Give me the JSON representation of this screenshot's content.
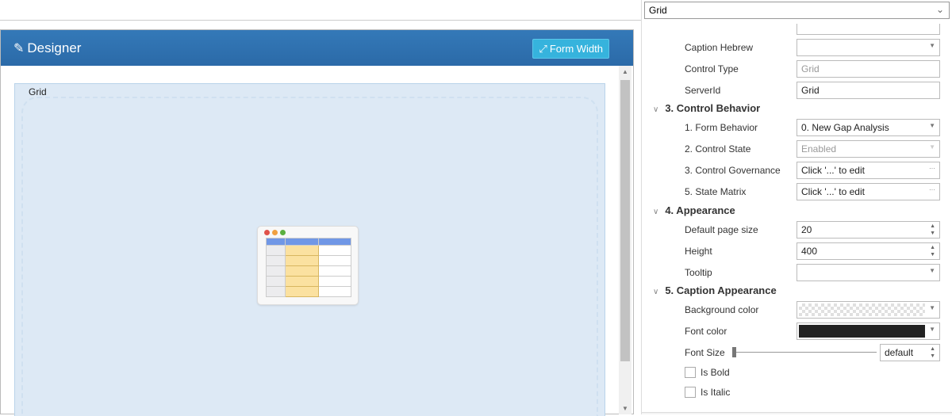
{
  "designer": {
    "title": "Designer",
    "form_width_label": "Form Width",
    "grid_label": "Grid"
  },
  "object_selector": {
    "value": "Grid"
  },
  "properties": {
    "caption_hebrew": {
      "label": "Caption Hebrew",
      "value": ""
    },
    "control_type": {
      "label": "Control Type",
      "value": "Grid"
    },
    "server_id": {
      "label": "ServerId",
      "value": "Grid"
    },
    "sections": [
      "3. Control Behavior",
      "4. Appearance",
      "5. Caption Appearance"
    ],
    "form_behavior": {
      "label": "1. Form Behavior",
      "value": "0. New Gap Analysis"
    },
    "control_state": {
      "label": "2. Control State",
      "value": "Enabled"
    },
    "control_governance": {
      "label": "3. Control Governance",
      "value": "Click '...' to edit"
    },
    "state_matrix": {
      "label": "5. State Matrix",
      "value": "Click '...' to edit"
    },
    "default_page_size": {
      "label": "Default page size",
      "value": "20"
    },
    "height": {
      "label": "Height",
      "value": "400"
    },
    "tooltip": {
      "label": "Tooltip",
      "value": ""
    },
    "background_color": {
      "label": "Background color",
      "value": "transparent"
    },
    "font_color": {
      "label": "Font color",
      "value": "#222222"
    },
    "font_size": {
      "label": "Font Size",
      "value": "default"
    },
    "is_bold": {
      "label": "Is Bold",
      "checked": false
    },
    "is_italic": {
      "label": "Is Italic",
      "checked": false
    }
  },
  "icons": {
    "ellipsis": "···"
  }
}
